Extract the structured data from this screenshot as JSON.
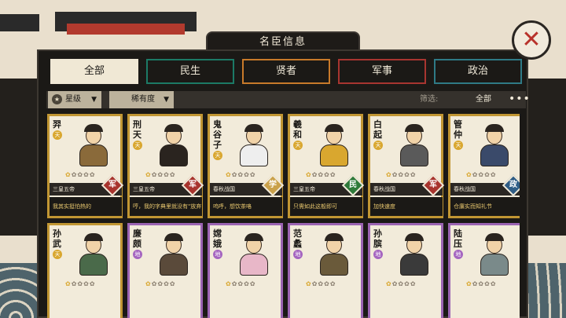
{
  "window": {
    "title": "名臣信息"
  },
  "colors": {
    "accent_gold": "#c19633",
    "accent_purple": "#9b64b3",
    "tab_green": "#1c7a66",
    "tab_orange": "#c87a2a",
    "tab_red": "#a83530",
    "tab_teal": "#2f7a86",
    "mil": "#a8342e",
    "civ": "#2e7a3a",
    "sage": "#caa14a",
    "gov": "#2f5d86"
  },
  "tabs": [
    {
      "label": "全部",
      "color": "#f0e8d5",
      "active": true
    },
    {
      "label": "民生",
      "color": "#1c7a66"
    },
    {
      "label": "贤者",
      "color": "#c87a2a"
    },
    {
      "label": "军事",
      "color": "#a83530"
    },
    {
      "label": "政治",
      "color": "#2f7a86"
    }
  ],
  "filters": {
    "sort1": "星级",
    "sort2": "稀有度",
    "filter_label": "筛选:",
    "filter_value": "全部",
    "more": "•••"
  },
  "cards": [
    {
      "name": "羿",
      "grade": "天",
      "era": "三皇五帝",
      "badge": "军",
      "badge_color": "#a8342e",
      "desc": "我其实挺怕热的",
      "rarity": "gold",
      "stars": 1,
      "robe": "#8a6a3a"
    },
    {
      "name": "刑天",
      "grade": "天",
      "era": "三皇五帝",
      "badge": "军",
      "badge_color": "#a8342e",
      "desc": "哼，我的字典里就没有\"放弃\"二字",
      "rarity": "gold",
      "stars": 1,
      "robe": "#2a241f"
    },
    {
      "name": "鬼谷子",
      "grade": "天",
      "era": "春秋战国",
      "badge": "学",
      "badge_color": "#caa14a",
      "desc": "呜呼，想饮茶咯",
      "rarity": "gold",
      "stars": 1,
      "robe": "#eee"
    },
    {
      "name": "羲和",
      "grade": "天",
      "era": "三皇五帝",
      "badge": "民",
      "badge_color": "#2e7a3a",
      "desc": "只需如此这般即可",
      "rarity": "gold",
      "stars": 1,
      "robe": "#d9a72f"
    },
    {
      "name": "白起",
      "grade": "天",
      "era": "春秋战国",
      "badge": "军",
      "badge_color": "#a8342e",
      "desc": "加快速度",
      "rarity": "gold",
      "stars": 1,
      "robe": "#5a5a5a"
    },
    {
      "name": "管仲",
      "grade": "天",
      "era": "春秋战国",
      "badge": "政",
      "badge_color": "#2f5d86",
      "desc": "仓廪实而知礼节",
      "rarity": "gold",
      "stars": 1,
      "robe": "#3a4a6a"
    },
    {
      "name": "孙武",
      "grade": "天",
      "rarity": "gold",
      "stars": 1,
      "robe": "#4a6a4a"
    },
    {
      "name": "廉颇",
      "grade": "地",
      "rarity": "purple",
      "stars": 1,
      "robe": "#5a4a3a"
    },
    {
      "name": "嫦娥",
      "grade": "地",
      "rarity": "purple",
      "stars": 1,
      "robe": "#e8b7c8"
    },
    {
      "name": "范蠡",
      "grade": "地",
      "rarity": "purple",
      "stars": 1,
      "robe": "#6a5a3a"
    },
    {
      "name": "孙膑",
      "grade": "地",
      "rarity": "purple",
      "stars": 1,
      "robe": "#3a3a3a"
    },
    {
      "name": "陆压",
      "grade": "地",
      "rarity": "purple",
      "stars": 1,
      "robe": "#7a8a8a"
    }
  ]
}
